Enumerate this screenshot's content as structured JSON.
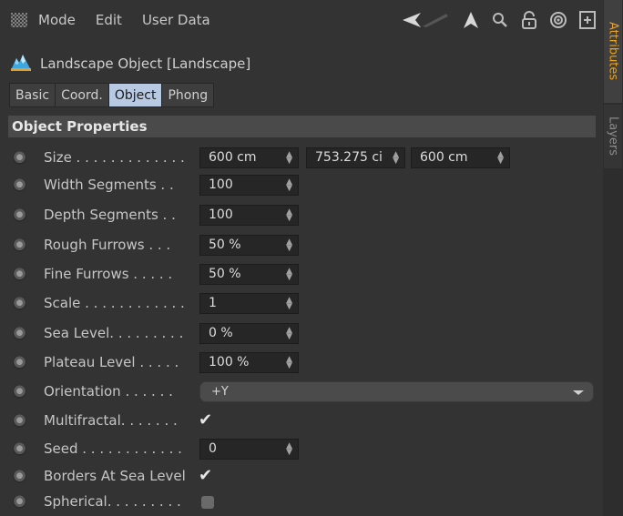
{
  "menubar": {
    "items": [
      "Mode",
      "Edit",
      "User Data"
    ]
  },
  "toolbar": {
    "icons": [
      "back-arrow-icon",
      "pointer-arrow-icon",
      "search-icon",
      "lock-icon",
      "target-icon",
      "new-panel-icon"
    ]
  },
  "object": {
    "title": "Landscape Object [Landscape]",
    "icon": "landscape-icon"
  },
  "tabs": [
    {
      "label": "Basic",
      "active": false
    },
    {
      "label": "Coord.",
      "active": false
    },
    {
      "label": "Object",
      "active": true
    },
    {
      "label": "Phong",
      "active": false
    }
  ],
  "section": {
    "title": "Object Properties"
  },
  "properties": {
    "size": {
      "label": "Size . . . . . . . . . . . . .",
      "x": "600 cm",
      "y": "753.275 ci",
      "z": "600 cm"
    },
    "width_seg": {
      "label": "Width Segments . .",
      "value": "100"
    },
    "depth_seg": {
      "label": "Depth Segments . .",
      "value": "100"
    },
    "rough": {
      "label": "Rough Furrows . . .",
      "value": "50 %"
    },
    "fine": {
      "label": "Fine Furrows . . . . .",
      "value": "50 %"
    },
    "scale": {
      "label": "Scale . . . . . . . . . . . .",
      "value": "1"
    },
    "sea": {
      "label": "Sea Level. . . . . . . . .",
      "value": "0 %"
    },
    "plateau": {
      "label": "Plateau Level  . . . . .",
      "value": "100 %"
    },
    "orientation": {
      "label": "Orientation  . . . . . .",
      "value": "+Y"
    },
    "multifractal": {
      "label": "Multifractal. . . . . . .",
      "checked": true
    },
    "seed": {
      "label": "Seed . . . . . . . . . . . .",
      "value": "0"
    },
    "borders": {
      "label": "Borders At Sea Level",
      "checked": true
    },
    "spherical": {
      "label": "Spherical. . . . . . . . .",
      "checked": false
    }
  },
  "side_tabs": [
    "Attributes",
    "Layers"
  ],
  "colors": {
    "active_tab": "#b7c9e3",
    "attributes_accent": "#e8a21e",
    "background": "#333333"
  }
}
